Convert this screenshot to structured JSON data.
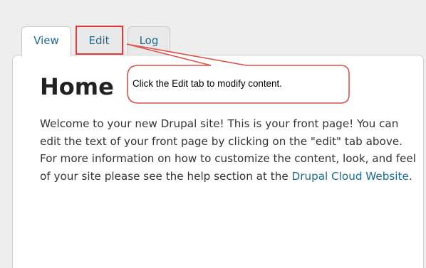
{
  "tabs": [
    {
      "label": "View",
      "active": true
    },
    {
      "label": "Edit",
      "active": false,
      "highlighted": true
    },
    {
      "label": "Log",
      "active": false
    }
  ],
  "content": {
    "title": "Home",
    "body_text": "Welcome to your new Drupal site! This is your front page! You can edit the text of your front page by clicking on the \"edit\" tab above. For more information on how to customize the content, look, and feel of your site please see the help section at the ",
    "link_text": "Drupal Cloud Website",
    "after_link": "."
  },
  "callout": {
    "text": "Click the Edit tab to modify content."
  },
  "colors": {
    "link": "#1a6b8f",
    "highlight_border": "#e03a3a",
    "callout_border": "#d9534f",
    "background": "#eeeeee"
  }
}
